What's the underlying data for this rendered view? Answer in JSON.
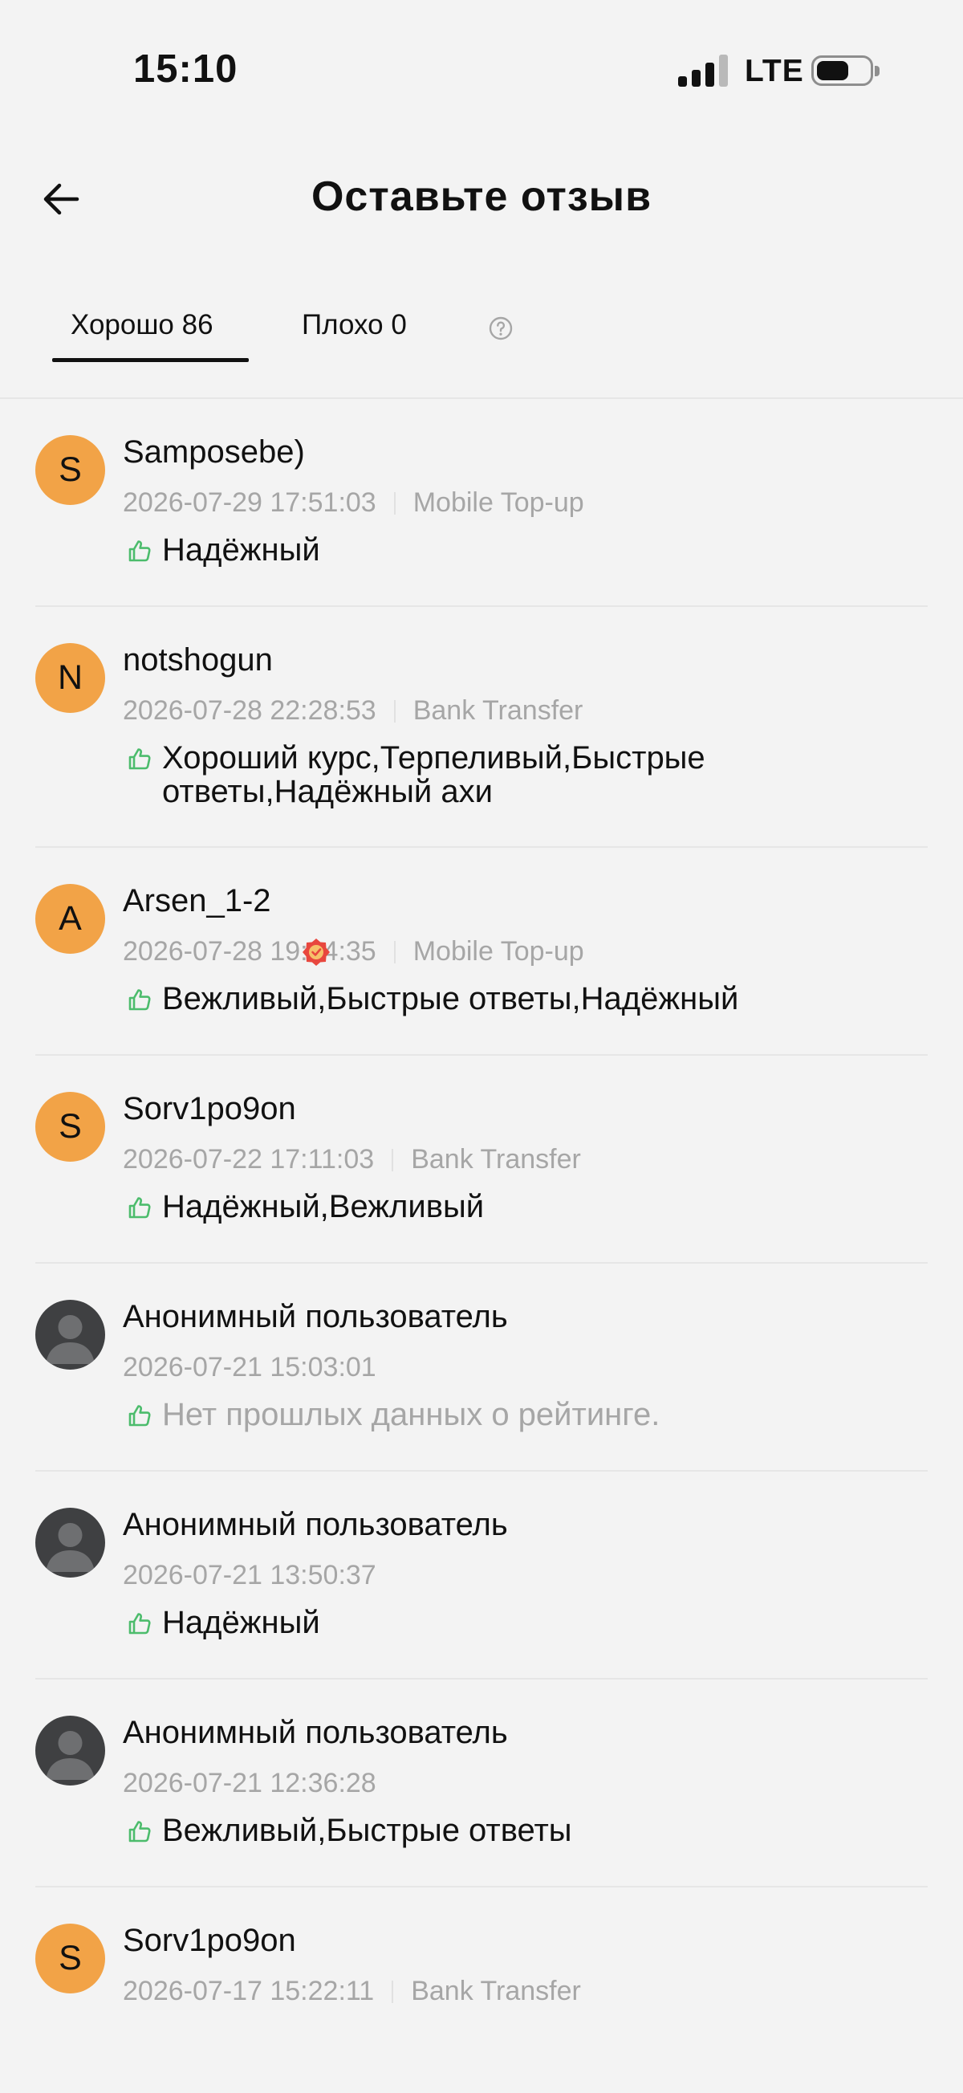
{
  "status_bar": {
    "time": "15:10",
    "network": "LTE",
    "signal_bars_active": 3,
    "signal_bars_total": 4,
    "battery_level": 0.6
  },
  "header": {
    "title": "Оставьте отзыв",
    "back_icon": "arrow-left-icon"
  },
  "tabs": {
    "good_label": "Хорошо 86",
    "bad_label": "Плохо 0",
    "active": "good",
    "help_icon": "question-circle-icon"
  },
  "colors": {
    "avatar_orange": "#f2a347",
    "avatar_anon": "#3f4042",
    "thumb_green": "#4cbc6c",
    "meta_gray": "#a6a6a6",
    "badge_red": "#e8473e"
  },
  "reviews": [
    {
      "initial": "S",
      "name": "Samposebe)",
      "date": "2026-07-29 17:51:03",
      "method": "Mobile Top-up",
      "tags": "Надёжный",
      "anonymous": false
    },
    {
      "initial": "N",
      "name": "notshogun",
      "date": "2026-07-28 22:28:53",
      "method": "Bank Transfer",
      "tags": "Хороший курс,Терпеливый,Быстрые ответы,Надёжный ахи",
      "anonymous": false
    },
    {
      "initial": "A",
      "name": "Arsen_1-2",
      "date": "2026-07-28 19:04:35",
      "method": "Mobile Top-up",
      "tags": "Вежливый,Быстрые ответы,Надёжный",
      "anonymous": false,
      "badge_icon": "verified-badge-icon"
    },
    {
      "initial": "S",
      "name": "Sorv1po9on",
      "date": "2026-07-22 17:11:03",
      "method": "Bank Transfer",
      "tags": "Надёжный,Вежливый",
      "anonymous": false
    },
    {
      "initial": "",
      "name": "Анонимный пользователь",
      "date": "2026-07-21 15:03:01",
      "method": "",
      "tags": "Нет прошлых данных о рейтинге.",
      "anonymous": true,
      "muted": true
    },
    {
      "initial": "",
      "name": "Анонимный пользователь",
      "date": "2026-07-21 13:50:37",
      "method": "",
      "tags": "Надёжный",
      "anonymous": true
    },
    {
      "initial": "",
      "name": "Анонимный пользователь",
      "date": "2026-07-21 12:36:28",
      "method": "",
      "tags": "Вежливый,Быстрые ответы",
      "anonymous": true
    },
    {
      "initial": "S",
      "name": "Sorv1po9on",
      "date": "2026-07-17 15:22:11",
      "method": "Bank Transfer",
      "tags": "",
      "anonymous": false
    }
  ]
}
